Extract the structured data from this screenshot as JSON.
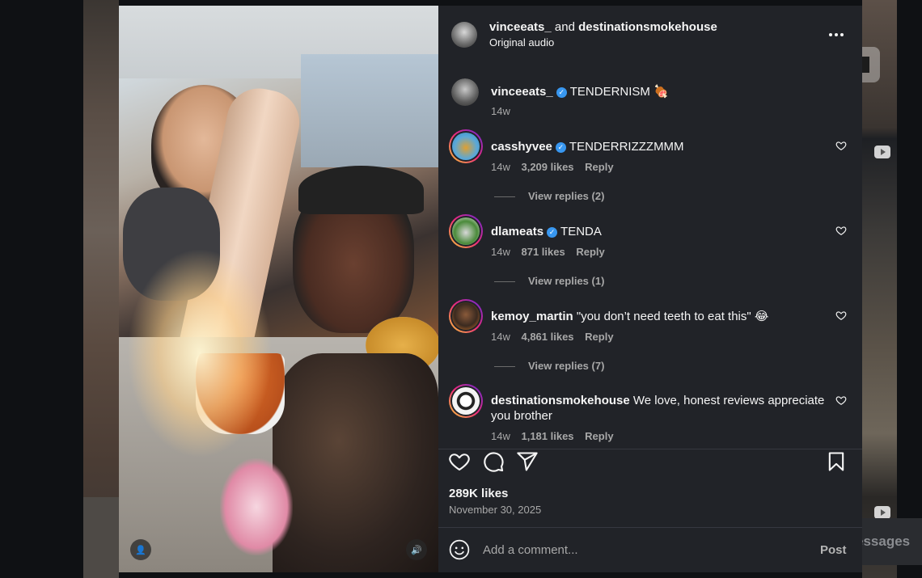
{
  "header": {
    "username1": "vinceeats_",
    "joiner": "and",
    "username2": "destinationsmokehouse",
    "audio": "Original audio"
  },
  "caption": {
    "username": "vinceeats_",
    "text": "TENDERNISM 🍖",
    "time": "14w"
  },
  "comments": [
    {
      "username": "casshyvee",
      "verified": true,
      "text": "TENDERRIZZZMMM",
      "time": "14w",
      "likes": "3,209 likes",
      "reply": "Reply",
      "view_replies": "View replies (2)"
    },
    {
      "username": "dlameats",
      "verified": true,
      "text": "TENDA",
      "time": "14w",
      "likes": "871 likes",
      "reply": "Reply",
      "view_replies": "View replies (1)"
    },
    {
      "username": "kemoy_martin",
      "verified": false,
      "text": "\"you don’t need teeth to eat this\" 😂",
      "time": "14w",
      "likes": "4,861 likes",
      "reply": "Reply",
      "view_replies": "View replies (7)"
    },
    {
      "username": "destinationsmokehouse",
      "verified": false,
      "text": "We love, honest reviews appreciate you brother",
      "time": "14w",
      "likes": "1,181 likes",
      "reply": "Reply"
    }
  ],
  "actions": {
    "like_count": "289K likes",
    "date": "November 30, 2025"
  },
  "composer": {
    "placeholder": "Add a comment...",
    "post_label": "Post"
  },
  "background": {
    "messages_label": "essages"
  },
  "icons": {
    "verified": "✓",
    "sound": "🔊",
    "user": "👤"
  },
  "colors": {
    "sidebar_bg": "#212328",
    "verified_blue": "#3897f0",
    "muted_text": "#a8a8a8"
  }
}
